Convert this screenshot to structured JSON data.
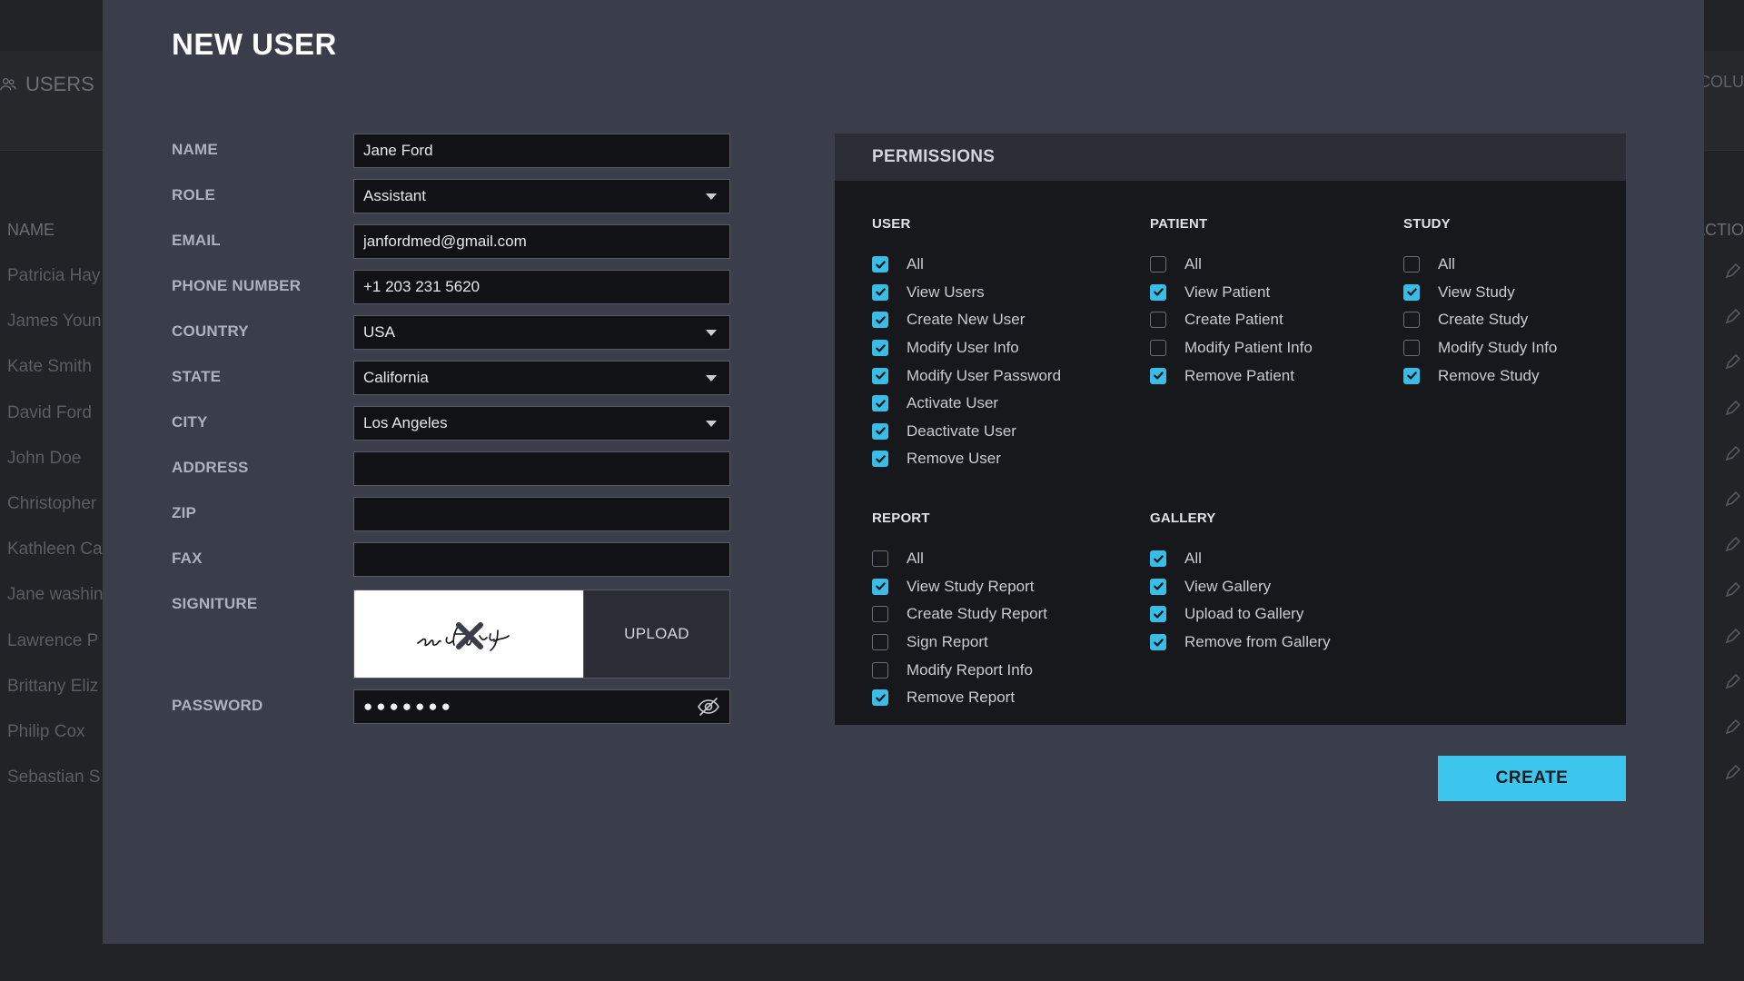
{
  "background": {
    "section_title": "USERS",
    "right_header": "COLU",
    "col_name": "NAME",
    "col_action": "ACTIO",
    "rows": [
      "Patricia Hay",
      "James Youn",
      "Kate Smith",
      "David Ford",
      "John Doe",
      "Christopher",
      "Kathleen Ca",
      "Jane washin",
      "Lawrence P",
      "Brittany Eliz",
      "Philip Cox",
      "Sebastian S"
    ]
  },
  "modal": {
    "title": "NEW USER",
    "form": {
      "name": {
        "label": "NAME",
        "value": "Jane Ford"
      },
      "role": {
        "label": "ROLE",
        "value": "Assistant"
      },
      "email": {
        "label": "EMAIL",
        "value": "janfordmed@gmail.com"
      },
      "phone": {
        "label": "PHONE NUMBER",
        "value": "+1 203 231 5620"
      },
      "country": {
        "label": "COUNTRY",
        "value": "USA"
      },
      "state": {
        "label": "STATE",
        "value": "California"
      },
      "city": {
        "label": "CITY",
        "value": "Los Angeles"
      },
      "address": {
        "label": "ADDRESS",
        "value": ""
      },
      "zip": {
        "label": "ZIP",
        "value": ""
      },
      "fax": {
        "label": "FAX",
        "value": ""
      },
      "signature": {
        "label": "SIGNITURE",
        "upload_label": "UPLOAD",
        "signature_text": "jan Fordg"
      },
      "password": {
        "label": "PASSWORD",
        "masked": "●●●●●●●"
      }
    },
    "permissions": {
      "title": "PERMISSIONS",
      "groups": [
        {
          "key": "user",
          "title": "USER",
          "items": [
            {
              "label": "All",
              "checked": true
            },
            {
              "label": "View Users",
              "checked": true
            },
            {
              "label": "Create New User",
              "checked": true
            },
            {
              "label": "Modify User Info",
              "checked": true
            },
            {
              "label": "Modify User Password",
              "checked": true
            },
            {
              "label": "Activate User",
              "checked": true
            },
            {
              "label": "Deactivate User",
              "checked": true
            },
            {
              "label": "Remove User",
              "checked": true
            }
          ]
        },
        {
          "key": "patient",
          "title": "PATIENT",
          "items": [
            {
              "label": "All",
              "checked": false
            },
            {
              "label": "View Patient",
              "checked": true
            },
            {
              "label": "Create Patient",
              "checked": false
            },
            {
              "label": "Modify Patient Info",
              "checked": false
            },
            {
              "label": "Remove Patient",
              "checked": true
            }
          ]
        },
        {
          "key": "study",
          "title": "STUDY",
          "items": [
            {
              "label": "All",
              "checked": false
            },
            {
              "label": "View Study",
              "checked": true
            },
            {
              "label": "Create Study",
              "checked": false
            },
            {
              "label": "Modify Study Info",
              "checked": false
            },
            {
              "label": "Remove Study",
              "checked": true
            }
          ]
        },
        {
          "key": "report",
          "title": "REPORT",
          "items": [
            {
              "label": "All",
              "checked": false
            },
            {
              "label": "View Study Report",
              "checked": true
            },
            {
              "label": "Create Study Report",
              "checked": false
            },
            {
              "label": "Sign Report",
              "checked": false
            },
            {
              "label": "Modify Report Info",
              "checked": false
            },
            {
              "label": "Remove Report",
              "checked": true
            }
          ]
        },
        {
          "key": "gallery",
          "title": "GALLERY",
          "items": [
            {
              "label": "All",
              "checked": true
            },
            {
              "label": "View Gallery",
              "checked": true
            },
            {
              "label": "Upload to Gallery",
              "checked": true
            },
            {
              "label": "Remove from Gallery",
              "checked": true
            }
          ]
        }
      ]
    },
    "create_label": "CREATE"
  },
  "colors": {
    "accent": "#3cc6ee",
    "checkbox_on": "#39bde6",
    "modal_bg": "#3a3d4a",
    "panel_bg": "#17181b"
  },
  "icons": [
    "users-icon",
    "caret-down-icon",
    "close-icon",
    "eye-off-icon",
    "check-icon",
    "pencil-icon"
  ]
}
